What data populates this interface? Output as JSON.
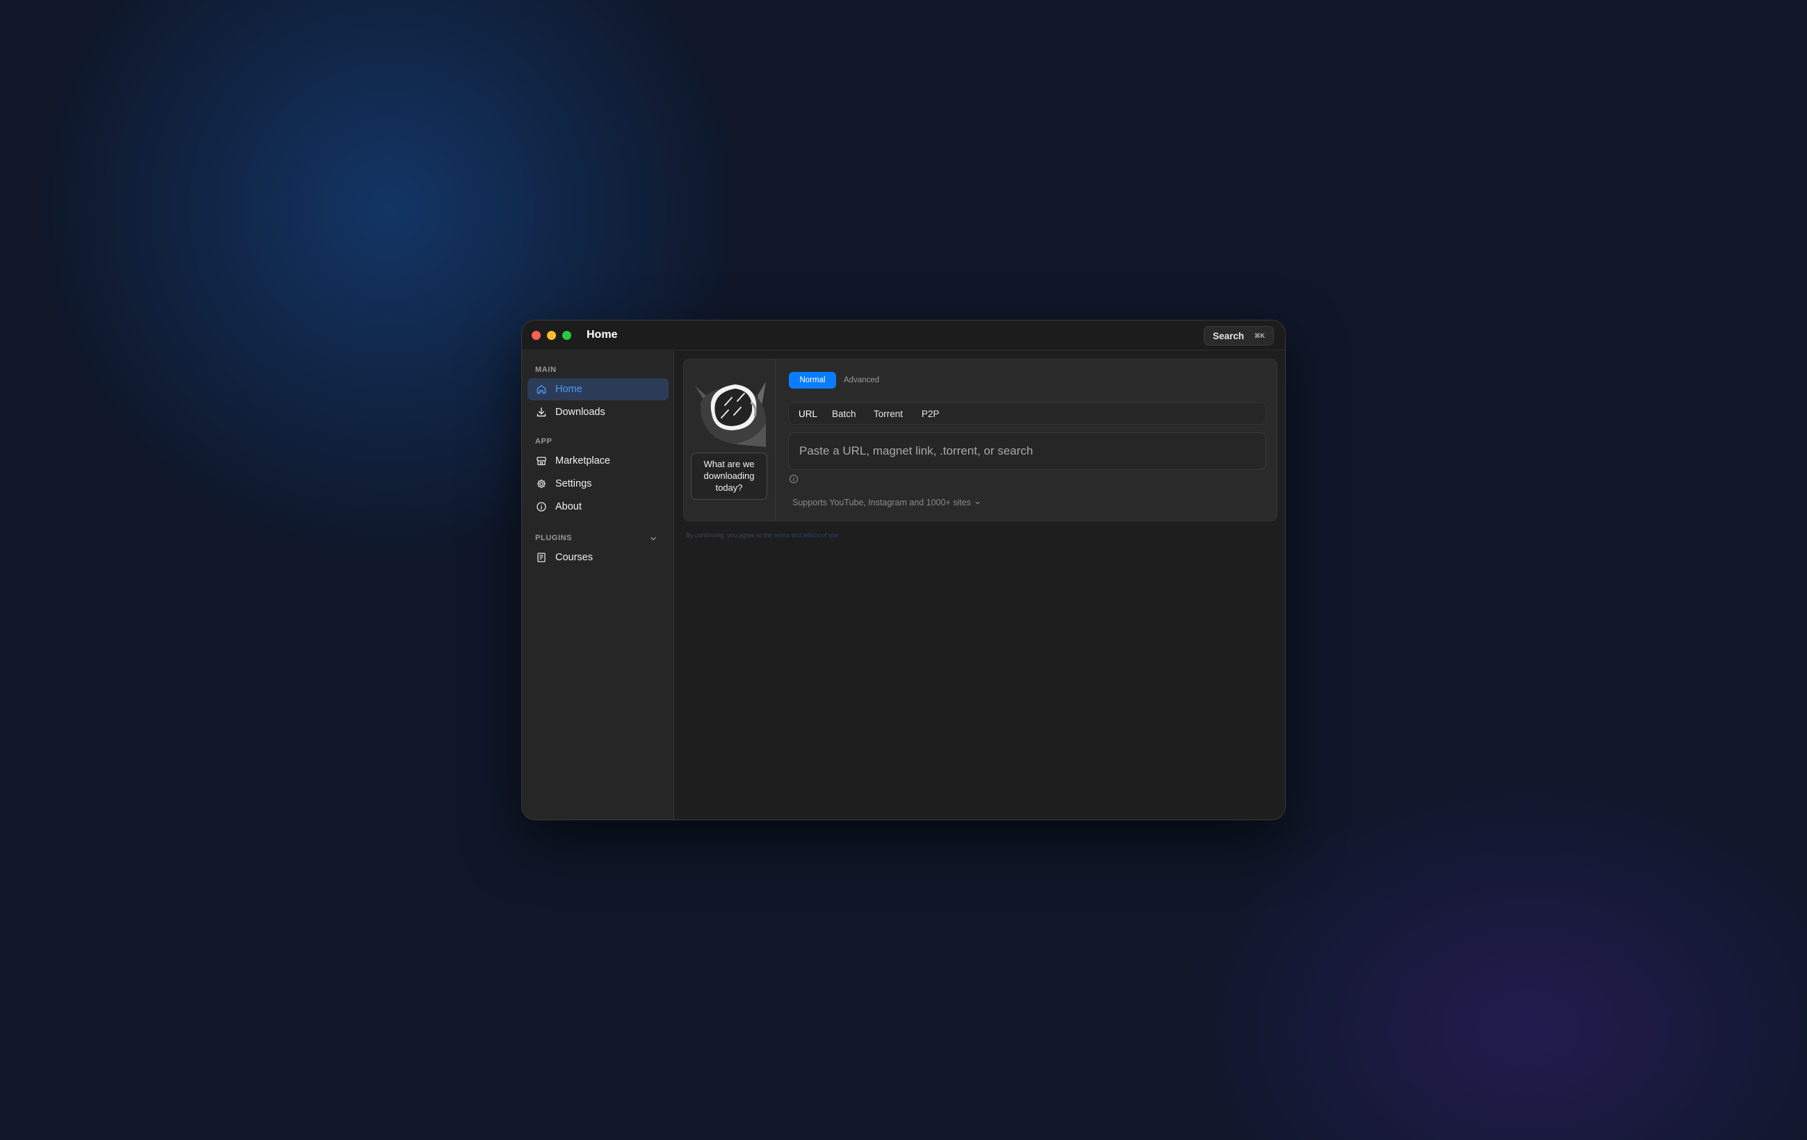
{
  "window": {
    "title": "Home",
    "search": {
      "label": "Search",
      "shortcut": "⌘K"
    }
  },
  "sidebar": {
    "sections": [
      {
        "label": "MAIN",
        "items": [
          {
            "label": "Home",
            "icon": "home-icon",
            "active": true
          },
          {
            "label": "Downloads",
            "icon": "download-icon",
            "active": false
          }
        ]
      },
      {
        "label": "APP",
        "items": [
          {
            "label": "Marketplace",
            "icon": "store-icon",
            "active": false
          },
          {
            "label": "Settings",
            "icon": "gear-icon",
            "active": false
          },
          {
            "label": "About",
            "icon": "info-icon",
            "active": false
          }
        ]
      },
      {
        "label": "PLUGINS",
        "collapsible": true,
        "items": [
          {
            "label": "Courses",
            "icon": "book-icon",
            "active": false
          }
        ]
      }
    ]
  },
  "main": {
    "prompt": "What are we downloading today?",
    "modes": {
      "normal": "Normal",
      "advanced": "Advanced",
      "selected": "Normal"
    },
    "tabs": [
      "URL",
      "Batch",
      "Torrent",
      "P2P"
    ],
    "active_tab": "URL",
    "input": {
      "placeholder": "Paste a URL, magnet link, .torrent, or search",
      "value": ""
    },
    "supports": "Supports YouTube, Instagram and 1000+ sites",
    "terms_prefix": "By continuing, you agree to the",
    "terms_link": "terms and ethics of use"
  },
  "colors": {
    "accent": "#0a7cff",
    "active_nav_bg": "#2c3c58",
    "active_nav_text": "#4a9df8",
    "window_bg": "#1e1e1e",
    "sidebar_bg": "#262626"
  }
}
